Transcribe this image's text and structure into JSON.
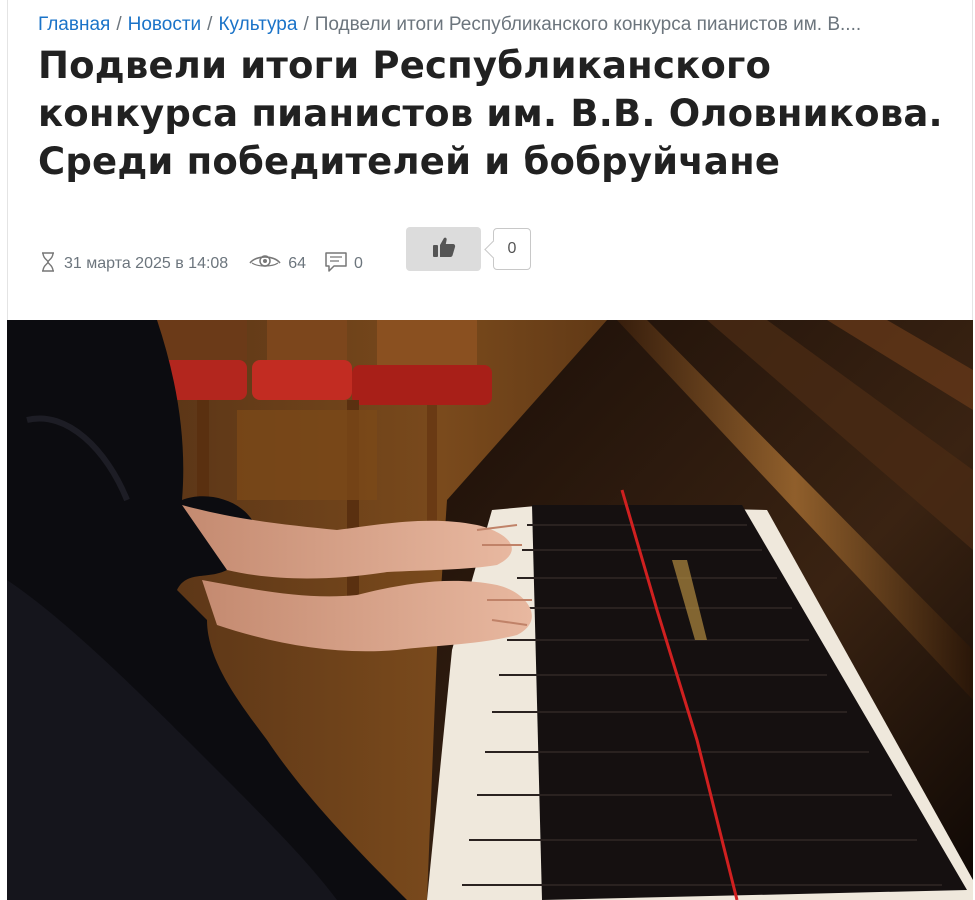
{
  "breadcrumb": {
    "items": [
      {
        "label": "Главная"
      },
      {
        "label": "Новости"
      },
      {
        "label": "Культура"
      }
    ],
    "separator": "/",
    "current": "Подвели итоги Республиканского конкурса пианистов им. В...."
  },
  "article": {
    "title": "Подвели итоги Республиканского конкурса пианистов им. В.В. Оловникова. Среди победителей и бобруйчане",
    "date": "31 марта 2025 в 14:08",
    "views": "64",
    "comments": "0",
    "likes": "0"
  },
  "icons": {
    "date": "hourglass-icon",
    "views": "eye-icon",
    "comments": "comment-icon",
    "like": "thumbs-up-icon"
  },
  "colors": {
    "link": "#1a73c8",
    "muted": "#6c757d",
    "title": "#212121",
    "like_button_bg": "#dcdcdc"
  }
}
